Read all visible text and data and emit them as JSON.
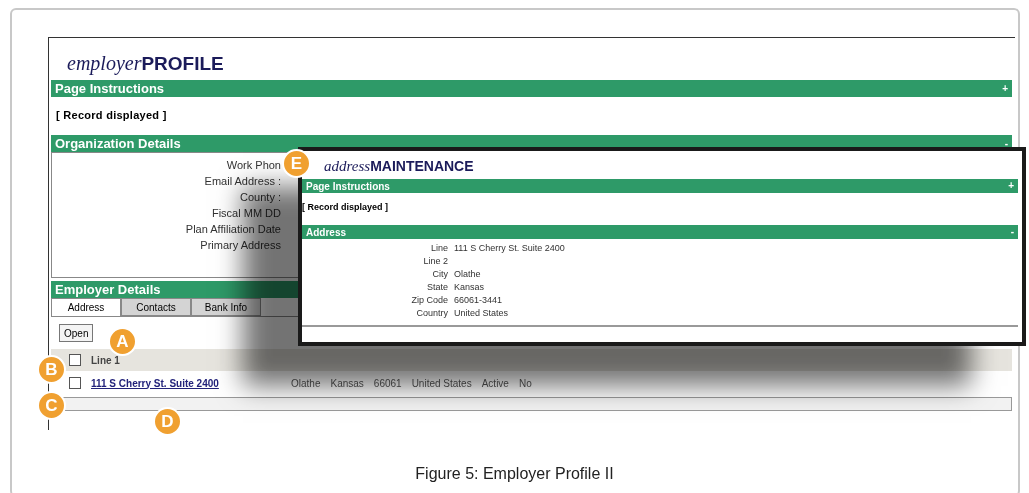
{
  "profile": {
    "title_prefix": "employer",
    "title_main": "PROFILE",
    "instructions": {
      "label": "Page Instructions",
      "toggle": "+"
    },
    "status": "[ Record displayed ]",
    "organization": {
      "label": "Organization Details",
      "toggle": "-",
      "fields": [
        "Work Phon",
        "Email Address :",
        "County :",
        "Fiscal MM DD",
        "Plan Affiliation Date",
        "Primary Address"
      ]
    },
    "employer_details": {
      "label": "Employer Details",
      "tabs": [
        {
          "label": "Address",
          "selected": true
        },
        {
          "label": "Contacts",
          "selected": false
        },
        {
          "label": "Bank Info",
          "selected": false
        }
      ],
      "open_button": "Open",
      "table": {
        "header": {
          "checked": false,
          "label": "Line 1"
        },
        "rows": [
          {
            "checked": false,
            "link": "111 S Cherry St. Suite 2400",
            "cells": [
              "Olathe",
              "Kansas",
              "66061",
              "United States",
              "Active",
              "No"
            ]
          }
        ]
      }
    }
  },
  "overlay": {
    "title_prefix": "address",
    "title_main": "MAINTENANCE",
    "instructions": {
      "label": "Page Instructions",
      "toggle": "+"
    },
    "status": "[ Record displayed ]",
    "address": {
      "label": "Address",
      "toggle": "-",
      "fields": [
        {
          "label": "Line",
          "value": "111 S Cherry St. Suite 2400"
        },
        {
          "label": "Line 2"
        },
        {
          "label": "City",
          "value": "Olathe"
        },
        {
          "label": "State",
          "value": "Kansas"
        },
        {
          "label": "Zip Code",
          "value": "66061-3441"
        },
        {
          "label": "Country",
          "value": "United States"
        }
      ]
    }
  },
  "callouts": [
    "A",
    "B",
    "C",
    "D",
    "E"
  ],
  "caption": "Figure 5: Employer Profile II"
}
